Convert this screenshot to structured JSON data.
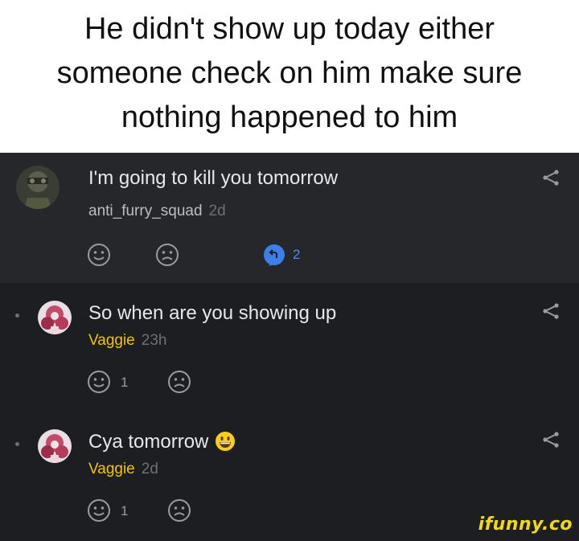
{
  "caption": "He didn't show up today either someone check on him make sure nothing happened to him",
  "post": {
    "text": "I'm going to kill you tomorrow",
    "username": "anti_furry_squad",
    "time": "2d",
    "reply_count": "2"
  },
  "comments": [
    {
      "text": "So when are you showing up",
      "username": "Vaggie",
      "time": "23h",
      "smile_count": "1"
    },
    {
      "text": "Cya tomorrow",
      "emoji": "grinning-face-emoji",
      "username": "Vaggie",
      "time": "2d",
      "smile_count": "1"
    }
  ],
  "watermark": "ifunny.co",
  "colors": {
    "background": "#1d1e22",
    "post_background": "#26272b",
    "username_gold": "#f2c500",
    "reply_blue": "#4a8cf0",
    "watermark": "#f5d90a"
  },
  "icons": [
    "share-icon",
    "smile-icon",
    "frown-icon",
    "reply-bubble-icon"
  ]
}
